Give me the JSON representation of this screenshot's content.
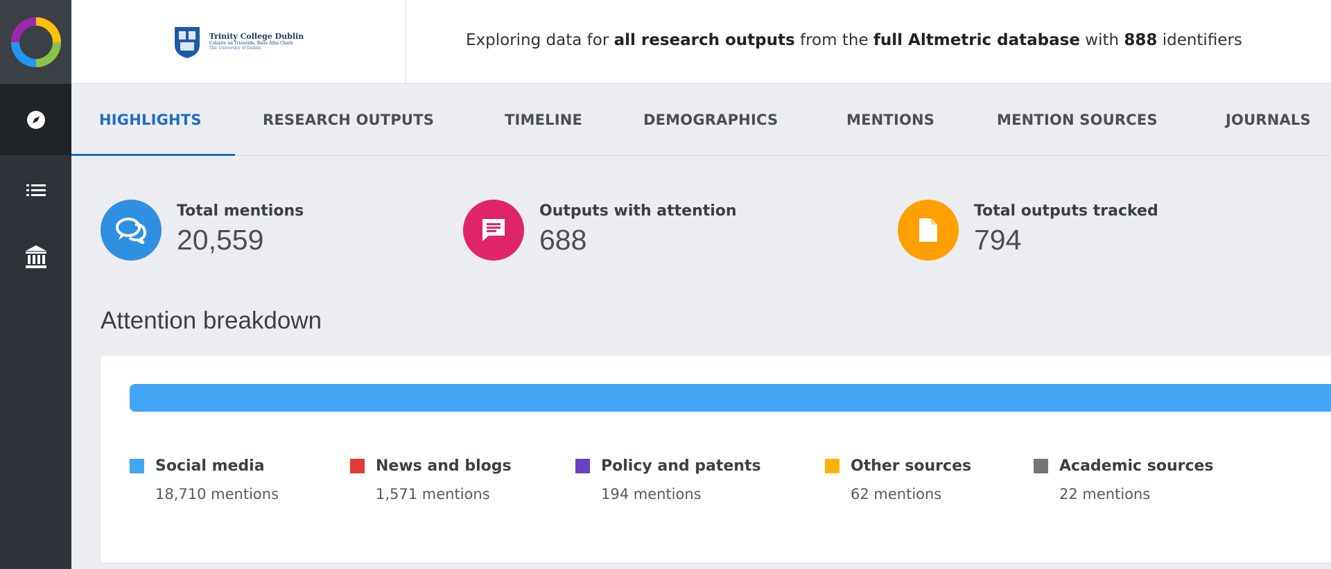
{
  "header": {
    "institution": {
      "name": "Trinity College Dublin",
      "subtitle": "Coláiste na Tríonóide, Baile Átha Cliath",
      "subtitle2": "The University of Dublin"
    },
    "explore_prefix": "Exploring data for ",
    "explore_scope": "all research outputs",
    "explore_mid": " from the ",
    "explore_source": "full Altmetric database",
    "explore_with": " with ",
    "explore_count": "888",
    "explore_suffix": " identifiers"
  },
  "tabs": [
    {
      "label": "HIGHLIGHTS",
      "active": true
    },
    {
      "label": "RESEARCH OUTPUTS",
      "active": false
    },
    {
      "label": "TIMELINE",
      "active": false
    },
    {
      "label": "DEMOGRAPHICS",
      "active": false
    },
    {
      "label": "MENTIONS",
      "active": false
    },
    {
      "label": "MENTION SOURCES",
      "active": false
    },
    {
      "label": "JOURNALS",
      "active": false
    }
  ],
  "sidebar": {
    "icons": [
      "altmetric-logo-icon",
      "compass-icon",
      "list-icon",
      "institution-icon"
    ]
  },
  "stats": [
    {
      "label": "Total mentions",
      "value": "20,559",
      "icon": "speech-bubbles-icon",
      "color": "#2f8fe0"
    },
    {
      "label": "Outputs with attention",
      "value": "688",
      "icon": "message-icon",
      "color": "#e0246a"
    },
    {
      "label": "Total outputs tracked",
      "value": "794",
      "icon": "document-icon",
      "color": "#ff9f00"
    }
  ],
  "breakdown": {
    "title": "Attention breakdown",
    "items": [
      {
        "name": "Social media",
        "count": "18,710 mentions",
        "value": 18710,
        "color": "#42a5f5"
      },
      {
        "name": "News and blogs",
        "count": "1,571 mentions",
        "value": 1571,
        "color": "#e53935"
      },
      {
        "name": "Policy and patents",
        "count": "194 mentions",
        "value": 194,
        "color": "#6a3fc1"
      },
      {
        "name": "Other sources",
        "count": "62 mentions",
        "value": 62,
        "color": "#ffb300"
      },
      {
        "name": "Academic sources",
        "count": "22 mentions",
        "value": 22,
        "color": "#757575"
      }
    ]
  }
}
